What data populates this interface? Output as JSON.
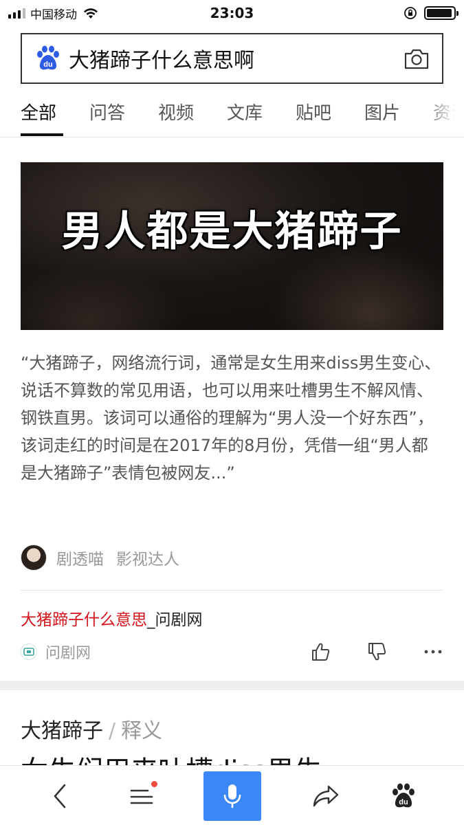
{
  "status_bar": {
    "carrier": "中国移动",
    "time": "23:03",
    "battery_level": 0.95
  },
  "search": {
    "query": "大猪蹄子什么意思啊",
    "logo_text": "du"
  },
  "tabs": [
    "全部",
    "问答",
    "视频",
    "文库",
    "贴吧",
    "图片",
    "资讯"
  ],
  "active_tab": "全部",
  "result": {
    "image_caption": "男人都是大猪蹄子",
    "summary": "“大猪蹄子，网络流行词，通常是女生用来diss男生变心、说话不算数的常见用语，也可以用来吐槽男生不解风情、钢铁直男。该词可以通俗的理解为“男人没一个好东西”，该词走红的时间是在2017年的8月份，凭借一组“男人都是大猪蹄子”表情包被网友...”",
    "author_name": "剧透喵",
    "author_title": "影视达人",
    "source_title_highlight": "大猪蹄子什么意思",
    "source_title_rest": "_问剧网",
    "site_name": "问剧网"
  },
  "next_result": {
    "heading": "大猪蹄子",
    "separator": "/",
    "subheading": "释义",
    "cut_text": "女生们用来吐槽diss男生"
  },
  "colors": {
    "accent_blue": "#3a87f5",
    "highlight_red": "#d3141b",
    "notification_red": "#f04a3e"
  },
  "icons": [
    "signal-icon",
    "wifi-icon",
    "orientation-lock-icon",
    "battery-icon",
    "baidu-paw-icon",
    "camera-icon",
    "thumbs-up-icon",
    "thumbs-down-icon",
    "more-icon",
    "back-icon",
    "menu-icon",
    "microphone-icon",
    "share-icon"
  ]
}
